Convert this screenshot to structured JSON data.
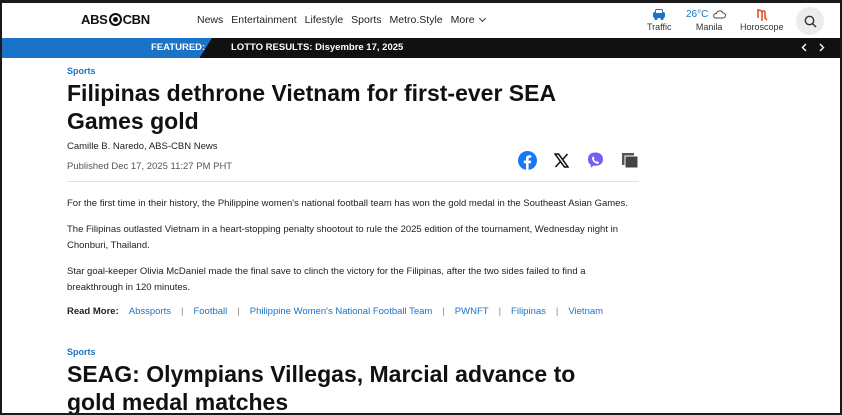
{
  "header": {
    "logo": "ABS CBN",
    "nav": [
      "News",
      "Entertainment",
      "Lifestyle",
      "Sports",
      "Metro.Style"
    ],
    "more_label": "More",
    "traffic_label": "Traffic",
    "weather_temp": "26°C",
    "weather_city": "Manila",
    "horoscope_label": "Horoscope"
  },
  "featured": {
    "label": "FEATURED:",
    "headline": "LOTTO RESULTS: Disyembre 17, 2025"
  },
  "article": {
    "category": "Sports",
    "title": "Filipinas dethrone Vietnam for first-ever SEA Games gold",
    "byline": "Camille B. Naredo, ABS-CBN News",
    "published": "Published Dec 17, 2025 11:27 PM PHT",
    "paragraphs": [
      "For the first time in their history, the Philippine women's national football team has won the gold medal in the Southeast Asian Games.",
      "The Filipinas outlasted Vietnam in a heart-stopping penalty shootout to rule the 2025 edition of the tournament, Wednesday night in Chonburi, Thailand.",
      "Star goal-keeper Olivia McDaniel made the final save to clinch the victory for the Filipinas, after the two sides failed to find a breakthrough in 120 minutes."
    ],
    "read_more_label": "Read More:",
    "tags": [
      "Abssports",
      "Football",
      "Philippine Women's National Football Team",
      "PWNFT",
      "Filipinas",
      "Vietnam"
    ]
  },
  "next_article": {
    "category": "Sports",
    "title": "SEAG: Olympians Villegas, Marcial advance to gold medal matches"
  },
  "colors": {
    "accent": "#1a73c7",
    "facebook": "#1877f2",
    "viber": "#7360f2",
    "horoscope": "#e0522b"
  }
}
